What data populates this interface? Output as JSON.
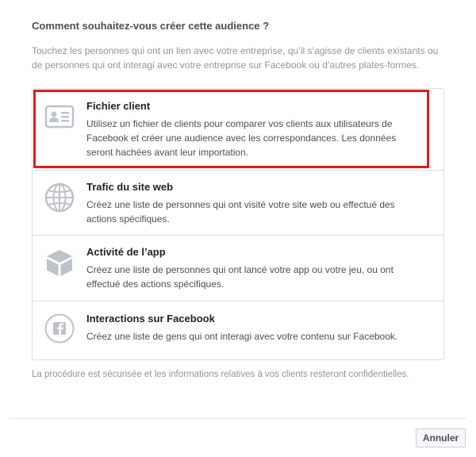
{
  "dialog": {
    "heading": "Comment souhaitez-vous créer cette audience ?",
    "intro": "Touchez les personnes qui ont un lien avec votre entreprise, qu’il s’agisse de clients existants ou de personnes qui ont interagi avec votre entreprise sur Facebook ou d’autres plates-formes.",
    "options": [
      {
        "title": "Fichier client",
        "description": "Utilisez un fichier de clients pour comparer vos clients aux utilisateurs de Facebook et créer une audience avec les correspondances. Les données seront hachées avant leur importation.",
        "icon": "contact-card-icon",
        "highlighted": true
      },
      {
        "title": "Trafic du site web",
        "description": "Créez une liste de personnes qui ont visité votre site web ou effectué des actions spécifiques.",
        "icon": "globe-icon"
      },
      {
        "title": "Activité de l’app",
        "description": "Créez une liste de personnes qui ont lancé votre app ou votre jeu, ou ont effectué des actions spécifiques.",
        "icon": "cube-icon"
      },
      {
        "title": "Interactions sur Facebook",
        "description": "Créez une liste de gens qui ont interagi avec votre contenu sur Facebook.",
        "icon": "facebook-icon"
      }
    ],
    "footer_note": "La procédure est sécurisée et les informations relatives à vos clients resteront confidentielles.",
    "cancel_label": "Annuler",
    "colors": {
      "highlight": "#e01b1b",
      "icon_gray": "#bec2c9",
      "border": "#dddfe2"
    }
  }
}
